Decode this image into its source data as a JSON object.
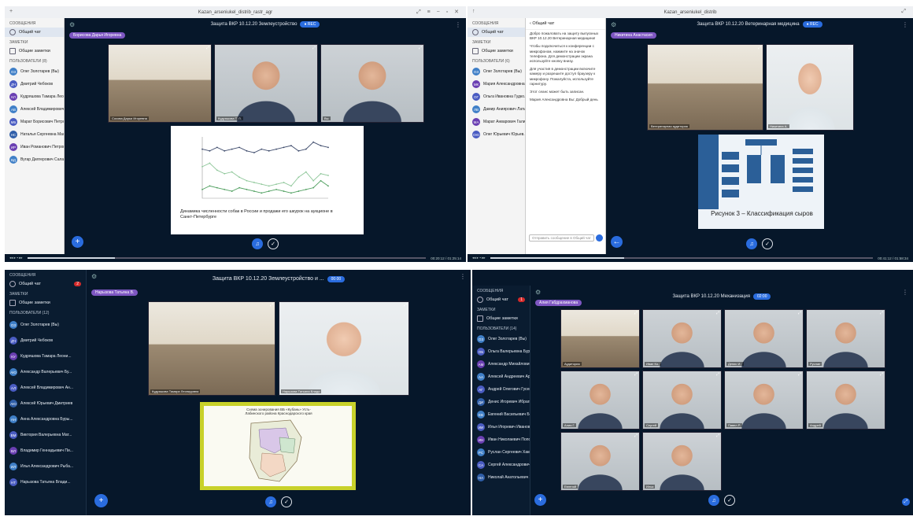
{
  "colors": {
    "panel_bg": "#06172a",
    "accent": "#2a6cde",
    "presenter": "#7e57c2",
    "badge": "#d52a2a"
  },
  "q1": {
    "window_title": "Kazan_arseniukel_distrib_rastr_agr",
    "sections": {
      "messages": "СООБЩЕНИЯ",
      "notes": "ЗАМЕТКИ",
      "users": "ПОЛЬЗОВАТЕЛИ (8)"
    },
    "public_chat": "Общий чат",
    "shared_notes": "Общие заметки",
    "meeting_title": "Защита ВКР 10.12.20 Землеустройство",
    "presenter": "Борисова Дарья Игоревна",
    "users": [
      {
        "init": "ОЗ",
        "name": "Олег Золотарев (Вы)",
        "color": "#3f7fc7"
      },
      {
        "init": "ДЧ",
        "name": "Дмитрий Чебоков",
        "color": "#4a5cc2"
      },
      {
        "init": "КЛ",
        "name": "Кудряшова Тамара Леонид..",
        "color": "#6a3fb2"
      },
      {
        "init": "АВ",
        "name": "Алексей Владимирович Ан..",
        "color": "#3f7fc7"
      },
      {
        "init": "МБ",
        "name": "Марат Борисович Петров",
        "color": "#4a5cc2"
      },
      {
        "init": "НС",
        "name": "Наталья Сергеевна Маслов..",
        "color": "#2f5ea8"
      },
      {
        "init": "ИР",
        "name": "Иван Романович Петров",
        "color": "#6a3fb2"
      },
      {
        "init": "ВД",
        "name": "Вугар Дилгерович Салаев",
        "color": "#3f7fc7"
      }
    ],
    "tile_names": [
      "Сосова Дарья Игоревна",
      "Кудряшова Т. Л.",
      "Вы"
    ],
    "slide_caption": "Динамика численности собак в России и продажи его шкурок на аукционе в Санкт-Петербурге",
    "chart_data": {
      "type": "line",
      "series": [
        {
          "values": [
            28,
            27,
            29,
            27,
            28,
            29,
            27,
            26,
            28,
            27,
            28,
            29,
            30,
            27,
            28,
            32,
            30,
            29
          ]
        },
        {
          "values": [
            18,
            20,
            16,
            14,
            15,
            12,
            10,
            9,
            8,
            7,
            8,
            9,
            7,
            12,
            15,
            10,
            14,
            13
          ]
        },
        {
          "values": [
            5,
            7,
            6,
            5,
            4,
            6,
            5,
            4,
            3,
            4,
            5,
            4,
            3,
            4,
            5,
            6,
            10,
            7
          ]
        }
      ],
      "ylim": [
        0,
        35
      ]
    },
    "timeline": "00:20:12 / 01:25:14"
  },
  "q2": {
    "window_title": "Kazan_arseniukel_distrib",
    "sections": {
      "messages": "СООБЩЕНИЯ",
      "notes": "ЗАМЕТКИ",
      "users": "ПОЛЬЗОВАТЕЛИ (6)"
    },
    "public_chat": "Общий чат",
    "shared_notes": "Общие заметки",
    "chat_header": "Общий чат",
    "meeting_title": "Защита ВКР 10.12.20 Ветеринарная медицина",
    "presenter": "Никитина Анастасия",
    "users": [
      {
        "init": "ОЗ",
        "name": "Олег Золотарев (Вы)",
        "color": "#3f7fc7"
      },
      {
        "init": "МК",
        "name": "Мария Александровна Ол..",
        "color": "#6a3fb2"
      },
      {
        "init": "ОГ",
        "name": "Ольга Ивановна Гудко..",
        "color": "#4a5cc2"
      },
      {
        "init": "ЛВ",
        "name": "Дамир Аниярович Латыпов..",
        "color": "#3f7fc7"
      },
      {
        "init": "МА",
        "name": "Марат Анварович Галиев..",
        "color": "#6a3fb2"
      },
      {
        "init": "ОЮ",
        "name": "Олег Юрьевич Юрьев..",
        "color": "#4a5cc2"
      }
    ],
    "chat_messages": [
      "Добро пожаловать на защиту выпускных ВКР 10.12.20 Ветеринарная медицина!",
      "Чтобы подключиться к конференции с микрофоном, нажмите на значок телефона. Для демонстрации экрана используйте кнопку внизу.",
      "Для участия в демонстрации включите камеру и разрешите доступ браузеру к микрофону. Пожалуйста, используйте гарнитуру.",
      "Этот сеанс может быть записан.",
      "Мария Александровна Вы: Добрый день"
    ],
    "chat_placeholder": "Отправить сообщение в Общий чат",
    "tile_names": [
      "Ветеринарная аудитория",
      "Никитина А."
    ],
    "slide_caption": "Рисунок 3 – Классификация сыров",
    "timeline": "00:41:12 / 01:58:34"
  },
  "q3": {
    "sections": {
      "messages": "СООБЩЕНИЯ",
      "notes": "ЗАМЕТКИ",
      "users": "ПОЛЬЗОВАТЕЛИ (12)"
    },
    "public_chat": "Общий чат",
    "chat_badge": "2",
    "shared_notes": "Общие заметки",
    "meeting_title": "Защита ВКР 10.12.20 Землеустройство и ...",
    "rec_label": "00:00",
    "presenter": "Нарызова Татьяна В.",
    "users": [
      {
        "init": "ОЗ",
        "name": "Олег Золотарев (Вы)",
        "color": "#3f7fc7"
      },
      {
        "init": "ДЧ",
        "name": "Дмитрий Чебоков",
        "color": "#4a5cc2"
      },
      {
        "init": "КУ",
        "name": "Кудряшова Тамара Леони...",
        "color": "#6a3fb2"
      },
      {
        "init": "АЮ",
        "name": "Александр Валерьевич Бу...",
        "color": "#3f7fc7"
      },
      {
        "init": "АЛ",
        "name": "Алексей Владимирович Ан...",
        "color": "#4a5cc2"
      },
      {
        "init": "АЮ",
        "name": "Алексей Юрьевич Дмитриев",
        "color": "#2f5ea8"
      },
      {
        "init": "АН",
        "name": "Анна Александровна Буры...",
        "color": "#3f7fc7"
      },
      {
        "init": "ВМ",
        "name": "Виктория Валерьевна Мат...",
        "color": "#4a5cc2"
      },
      {
        "init": "ВЛ",
        "name": "Владимир Геннадьевич Пи...",
        "color": "#6a3fb2"
      },
      {
        "init": "ИЛ",
        "name": "Илья Александрович Рыба...",
        "color": "#3f7fc7"
      },
      {
        "init": "НТ",
        "name": "Нарызова Татьяна Влади...",
        "color": "#4a5cc2"
      }
    ],
    "tile_names": [
      "Кудряшова Тамара Леонидовна",
      "Нарызова Татьяна Влади"
    ],
    "slide_caption": "Схема зонирования ВБ «Кубань» Усть-Лабинского района Краснодарского края"
  },
  "q4": {
    "sections": {
      "messages": "СООБЩЕНИЯ",
      "notes": "ЗАМЕТКИ",
      "users": "ПОЛЬЗОВАТЕЛИ (14)"
    },
    "public_chat": "Общий чат",
    "chat_badge": "1",
    "shared_notes": "Общие заметки",
    "meeting_title": "Защита ВКР 10.12.20 Механизация",
    "rec_label": "02:00",
    "presenter": "Алия Габдрахманова",
    "users": [
      {
        "init": "ОЗ",
        "name": "Олег Золотарев (Вы)",
        "color": "#3f7fc7"
      },
      {
        "init": "ОБ",
        "name": "Ольга Валерьевна Буряк..",
        "color": "#4a5cc2"
      },
      {
        "init": "АМ",
        "name": "Александр Михайлович Гу..",
        "color": "#6a3fb2"
      },
      {
        "init": "АА",
        "name": "Алексей Андреевич Ар..",
        "color": "#3f7fc7"
      },
      {
        "init": "АГ",
        "name": "Андрей Олегович Гусев..",
        "color": "#4a5cc2"
      },
      {
        "init": "ДИ",
        "name": "Денис Игоревич Ибрагим..",
        "color": "#2f5ea8"
      },
      {
        "init": "ЕВ",
        "name": "Евгений Васильевич Бо..",
        "color": "#3f7fc7"
      },
      {
        "init": "ИИ",
        "name": "Илья Игоревич Иванов..",
        "color": "#4a5cc2"
      },
      {
        "init": "ИН",
        "name": "Иван Николаевич Попов..",
        "color": "#6a3fb2"
      },
      {
        "init": "РС",
        "name": "Руслан Сергеевич Хакимов",
        "color": "#3f7fc7"
      },
      {
        "init": "СА",
        "name": "Сергей Александрович Фед..",
        "color": "#4a5cc2"
      },
      {
        "init": "НА",
        "name": "Николай Анатольевич Ж..",
        "color": "#2f5ea8"
      }
    ],
    "tile_names": [
      "Аудитория",
      "Иван Ко..",
      "Денис И..",
      "Руслан",
      "Алия Г.",
      "Сергей",
      "Павел Р.",
      "Андрей",
      "Евгений",
      "Илья"
    ]
  }
}
